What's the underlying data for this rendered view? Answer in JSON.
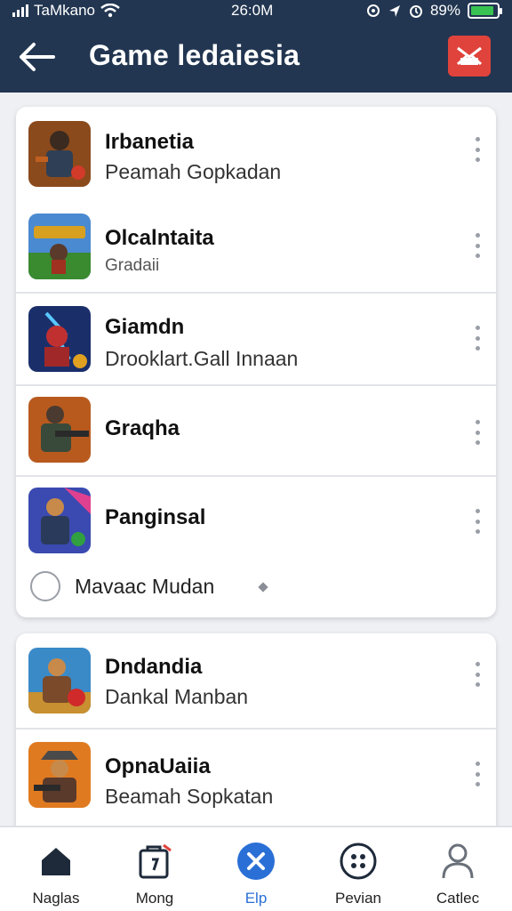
{
  "status_bar": {
    "carrier": "TaMkano",
    "time": "26:0M",
    "battery": "89%",
    "battery_level": 0.89
  },
  "header": {
    "title": "Game ledaiesia",
    "back_icon": "back-arrow-icon",
    "action_icon": "envelope-icon"
  },
  "list_card1": {
    "items": [
      {
        "name": "Irbanetia",
        "subtitle": "Peamah Gopkadan",
        "icon": "soldier-game-icon"
      },
      {
        "name": "Olcalntaita",
        "subtitle": "Gradaii",
        "icon": "arena-game-icon"
      },
      {
        "name": "Giamdn",
        "subtitle": "Drooklart.Gall Innaan",
        "icon": "hero-game-icon"
      },
      {
        "name": "Graqha",
        "subtitle": "",
        "icon": "shooter-game-icon"
      },
      {
        "name": "Panginsal",
        "subtitle": "",
        "icon": "warrior-game-icon"
      }
    ],
    "radio_option": "Mavaac Mudan"
  },
  "list_card2": {
    "items": [
      {
        "name": "Dndandia",
        "subtitle": "Dankal Manban",
        "icon": "pirate-game-icon"
      },
      {
        "name": "OpnaUaiia",
        "subtitle": "Beamah Sopkatan",
        "icon": "gunner-game-icon"
      }
    ]
  },
  "bottom_nav": {
    "items": [
      {
        "label": "Naglas",
        "icon": "home-icon"
      },
      {
        "label": "Mong",
        "icon": "bag-icon"
      },
      {
        "label": "Elp",
        "icon": "close-circle-icon",
        "active": true
      },
      {
        "label": "Pevian",
        "icon": "dots-circle-icon"
      },
      {
        "label": "Catlec",
        "icon": "person-icon"
      }
    ]
  },
  "colors": {
    "header_bg": "#223651",
    "accent_red": "#e0433b",
    "active_blue": "#2a6fd6",
    "battery_green": "#38c251"
  }
}
